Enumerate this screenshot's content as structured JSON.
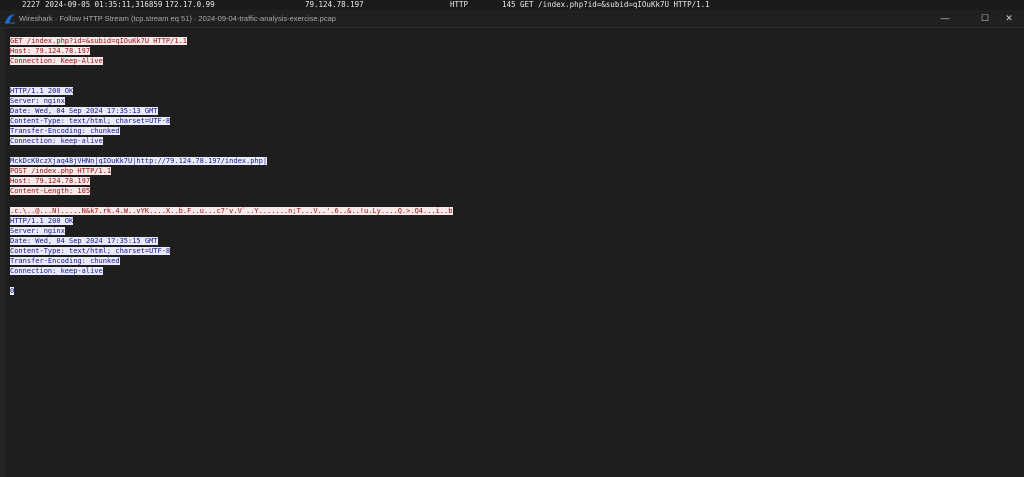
{
  "packet_row": {
    "number": "2227",
    "time": "2024-09-05 01:35:11,316859",
    "source": "172.17.0.99",
    "destination": "79.124.78.197",
    "protocol": "HTTP",
    "length": "145",
    "info": "GET /index.php?id=&subid=qIOuKk7U HTTP/1.1"
  },
  "window": {
    "title": "Wireshark · Follow HTTP Stream (tcp.stream eq 51) · 2024-09-04-traffic-analysis-exercise.pcap",
    "minimize_glyph": "—",
    "maximize_glyph": "☐",
    "close_glyph": "✕",
    "icon": "wireshark-fin-icon"
  },
  "colors": {
    "client_bg": "#f7e8ea",
    "client_text": "#9a1010",
    "server_bg": "#e8eaf9",
    "server_text": "#1a1a8c",
    "background": "#1e1e1e"
  },
  "stream_lines": [
    {
      "dir": "client",
      "text": "GET /index.php?id=&subid=qIOuKk7U HTTP/1.1"
    },
    {
      "dir": "client",
      "text": "Host: 79.124.78.197"
    },
    {
      "dir": "client",
      "text": "Connection: Keep-Alive"
    },
    {
      "dir": "blank",
      "text": ""
    },
    {
      "dir": "blank",
      "text": ""
    },
    {
      "dir": "server",
      "text": "HTTP/1.1 200 OK"
    },
    {
      "dir": "server",
      "text": "Server: nginx"
    },
    {
      "dir": "server",
      "text": "Date: Wed, 04 Sep 2024 17:35:13 GMT"
    },
    {
      "dir": "server",
      "text": "Content-Type: text/html; charset=UTF-8"
    },
    {
      "dir": "server",
      "text": "Transfer-Encoding: chunked"
    },
    {
      "dir": "server",
      "text": "Connection: keep-alive"
    },
    {
      "dir": "blank",
      "text": ""
    },
    {
      "dir": "server",
      "text": "MckDcK0czXjaq48jVHNn|qIOuKk7U|http://79.124.78.197/index.php|"
    },
    {
      "dir": "client",
      "text": "POST /index.php HTTP/1.1"
    },
    {
      "dir": "client",
      "text": "Host: 79.124.78.197"
    },
    {
      "dir": "client",
      "text": "Content-Length: 105"
    },
    {
      "dir": "blank",
      "text": ""
    },
    {
      "dir": "client",
      "text": ".c.\\..@...N).....N&k7.rk.4.W..vYK....X..b.F..u...c7'v.V`..Y.......n;T...V..'.6..&..!u.Ly....Q.>.Q4...i..b"
    },
    {
      "dir": "server",
      "text": "HTTP/1.1 200 OK"
    },
    {
      "dir": "server",
      "text": "Server: nginx"
    },
    {
      "dir": "server",
      "text": "Date: Wed, 04 Sep 2024 17:35:15 GMT"
    },
    {
      "dir": "server",
      "text": "Content-Type: text/html; charset=UTF-8"
    },
    {
      "dir": "server",
      "text": "Transfer-Encoding: chunked"
    },
    {
      "dir": "server",
      "text": "Connection: keep-alive"
    },
    {
      "dir": "blank",
      "text": ""
    },
    {
      "dir": "server",
      "text": "0"
    }
  ]
}
